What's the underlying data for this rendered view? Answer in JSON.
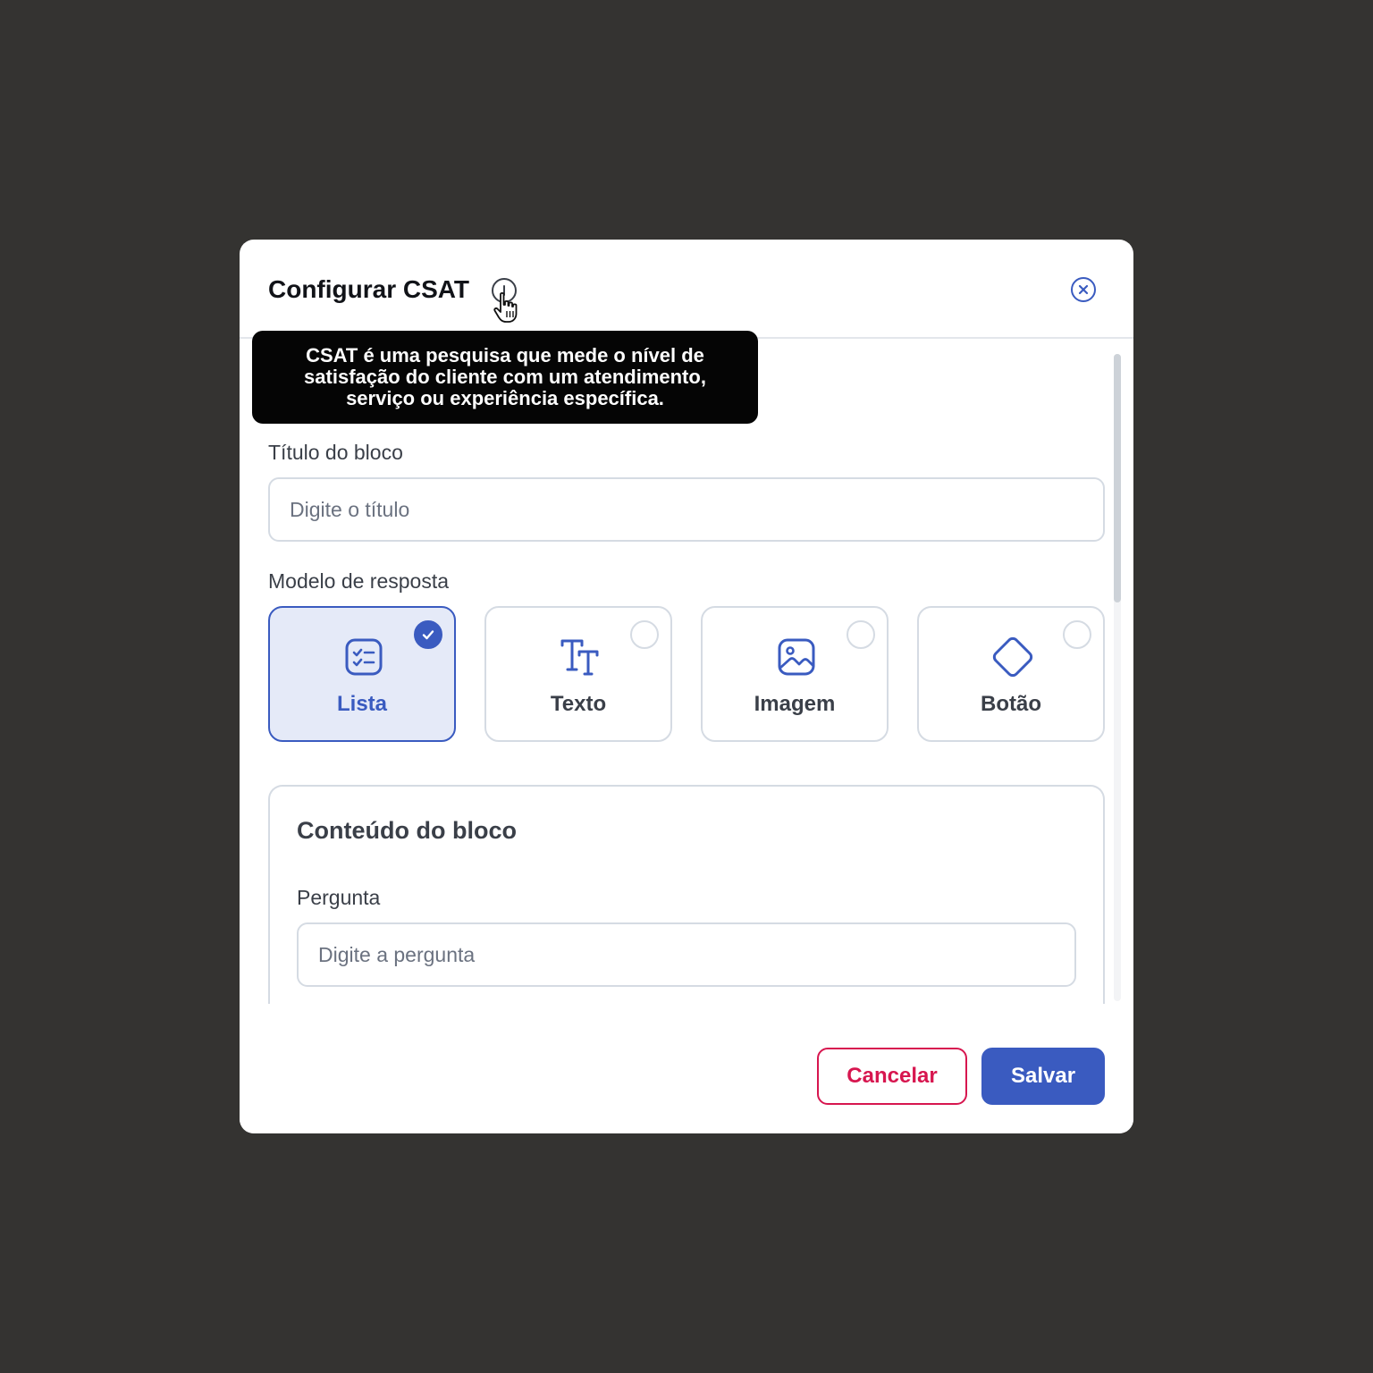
{
  "modal": {
    "title": "Configurar CSAT",
    "info_icon": "info-icon",
    "close_icon": "close-circle-icon",
    "tooltip_lines": [
      "CSAT é uma pesquisa que mede o nível de",
      "satisfação do cliente com um atendimento,",
      "serviço ou experiência específica."
    ]
  },
  "form": {
    "title_label": "Título do bloco",
    "title_placeholder": "Digite o título",
    "title_value": "",
    "model_label": "Modelo de resposta",
    "options": [
      {
        "label": "Lista",
        "icon": "list-checks-icon",
        "selected": true
      },
      {
        "label": "Texto",
        "icon": "text-type-icon",
        "selected": false
      },
      {
        "label": "Imagem",
        "icon": "image-icon",
        "selected": false
      },
      {
        "label": "Botão",
        "icon": "diamond-button-icon",
        "selected": false
      }
    ]
  },
  "content_block": {
    "title": "Conteúdo do bloco",
    "question_label": "Pergunta",
    "question_placeholder": "Digite a pergunta",
    "question_value": ""
  },
  "footer": {
    "cancel_label": "Cancelar",
    "save_label": "Salvar"
  },
  "colors": {
    "accent": "#3a5bc0",
    "danger": "#d7164f",
    "backdrop": "#343331",
    "selected_bg": "#e5eaf8"
  }
}
